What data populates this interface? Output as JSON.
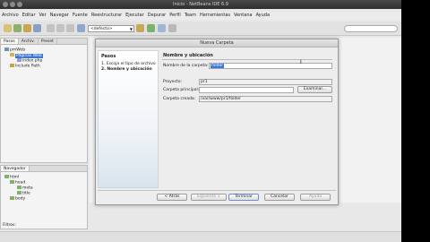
{
  "window": {
    "title": "Inicio - NetBeans IDE 6.9"
  },
  "menubar": [
    "Archivo",
    "Editar",
    "Ver",
    "Navegar",
    "Fuente",
    "Reestructurar",
    "Ejecutar",
    "Depurar",
    "Perfil",
    "Team",
    "Herramientas",
    "Ventana",
    "Ayuda"
  ],
  "toolbar": {
    "config_combo": "<defecto>"
  },
  "projects_panel": {
    "tabs": [
      "Pasos",
      "Archiv.",
      "Preset"
    ],
    "tree": [
      "pmWeb",
      "Páginas Web",
      "index.php",
      "Include Path"
    ]
  },
  "navigator_panel": {
    "tab": "Navegador",
    "tree": [
      "html",
      "head",
      "meta",
      "title",
      "body"
    ],
    "filter_label": "Filtros:"
  },
  "dialog": {
    "title": "Nueva Carpeta",
    "steps_title": "Pasos",
    "steps": [
      "1.  Escoja el tipo de archivo",
      "2.  Nombre y ubicación"
    ],
    "content_title": "Nombre y ubicación",
    "folder_name_label": "Nombre de la carpeta:",
    "folder_name_value": "folder",
    "project_label": "Proyecto:",
    "project_value": "pr1",
    "parent_folder_label": "Carpeta principal:",
    "parent_folder_value": "",
    "browse_label": "Examinar...",
    "created_folder_label": "Carpeta creada:",
    "created_folder_value": "/var/www/pr1/folder",
    "buttons": {
      "back": "< Atrás",
      "next": "Siguiente >",
      "finish": "Terminar",
      "cancel": "Cancelar",
      "help": "Ayuda"
    }
  }
}
